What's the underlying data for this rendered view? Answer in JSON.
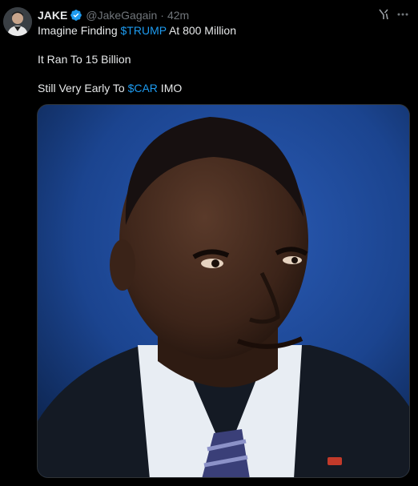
{
  "author": {
    "display_name": "JAKE",
    "handle": "@JakeGagain",
    "separator": "·",
    "time": "42m",
    "verified": true
  },
  "icons": {
    "verified": "verified-badge-icon",
    "grok": "grok-icon",
    "more": "more-options-icon"
  },
  "tweet": {
    "line1_prefix": "Imagine Finding ",
    "line1_cashtag": "$TRUMP",
    "line1_suffix": " At 800 Million",
    "line2": "It Ran To 15 Billion",
    "line3_prefix": "Still Very Early To ",
    "line3_cashtag": "$CAR",
    "line3_suffix": " IMO"
  },
  "colors": {
    "background": "#000000",
    "text": "#e7e9ea",
    "secondary": "#71767b",
    "accent": "#1d9bf0",
    "photo_backdrop": "#1a3f86"
  }
}
